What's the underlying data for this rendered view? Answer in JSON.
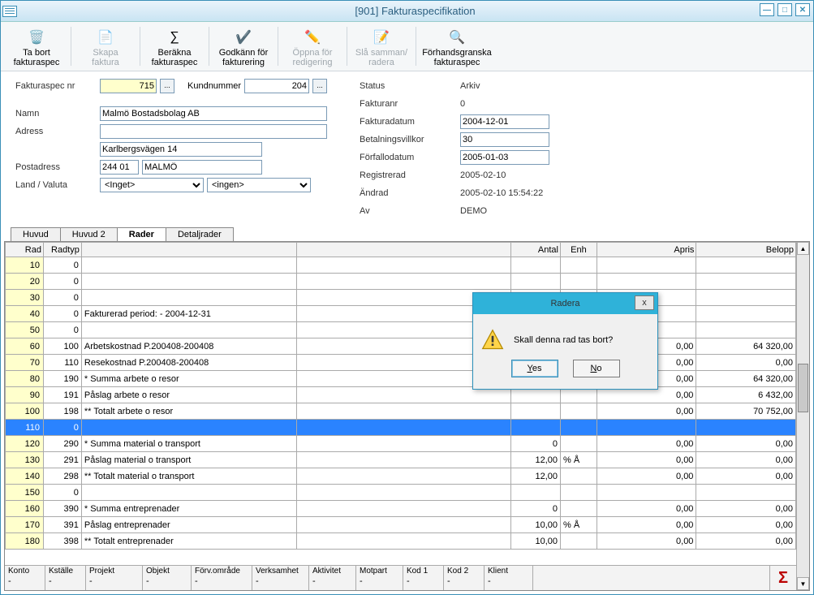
{
  "window": {
    "title": "[901]  Fakturaspecifikation"
  },
  "toolbar": {
    "remove": {
      "l1": "Ta bort",
      "l2": "fakturaspec"
    },
    "create": {
      "l1": "Skapa",
      "l2": "faktura"
    },
    "calc": {
      "l1": "Beräkna",
      "l2": "fakturaspec"
    },
    "approve": {
      "l1": "Godkänn för",
      "l2": "fakturering"
    },
    "openedit": {
      "l1": "Öppna för",
      "l2": "redigering"
    },
    "merge": {
      "l1": "Slå samman/",
      "l2": "radera"
    },
    "preview": {
      "l1": "Förhandsgranska",
      "l2": "fakturaspec"
    }
  },
  "form": {
    "labels": {
      "fakturaspec_nr": "Fakturaspec nr",
      "kundnummer": "Kundnummer",
      "namn": "Namn",
      "adress": "Adress",
      "postadress": "Postadress",
      "land_valuta": "Land / Valuta",
      "status": "Status",
      "fakturanr": "Fakturanr",
      "fakturadatum": "Fakturadatum",
      "betalningsvillkor": "Betalningsvillkor",
      "forfallodatum": "Förfallodatum",
      "registrerad": "Registrerad",
      "andrad": "Ändrad",
      "av": "Av"
    },
    "values": {
      "fakturaspec_nr": "715",
      "kundnummer": "204",
      "namn": "Malmö Bostadsbolag AB",
      "adress": "",
      "adress2": "Karlbergsvägen 14",
      "postnr": "244 01",
      "postort": "MALMÖ",
      "land_sel": "<Inget>",
      "valuta_sel": "<ingen>",
      "status": "Arkiv",
      "fakturanr": "0",
      "fakturadatum": "2004-12-01",
      "betalningsvillkor": "30",
      "forfallodatum": "2005-01-03",
      "registrerad": "2005-02-10",
      "andrad": "2005-02-10 15:54:22",
      "av": "DEMO"
    }
  },
  "tabs": {
    "t1": "Huvud",
    "t2": "Huvud 2",
    "t3": "Rader",
    "t4": "Detaljrader"
  },
  "grid": {
    "headers": {
      "rad": "Rad",
      "radtyp": "Radtyp",
      "text": "",
      "antal": "Antal",
      "enh": "Enh",
      "apris": "Apris",
      "belopp": "Belopp"
    },
    "rows": [
      {
        "rad": "10",
        "radtyp": "0",
        "text": "",
        "antal": "",
        "enh": "",
        "apris": "",
        "belopp": "",
        "sel": false
      },
      {
        "rad": "20",
        "radtyp": "0",
        "text": "",
        "antal": "",
        "enh": "",
        "apris": "",
        "belopp": "",
        "sel": false
      },
      {
        "rad": "30",
        "radtyp": "0",
        "text": "",
        "antal": "",
        "enh": "",
        "apris": "",
        "belopp": "",
        "sel": false
      },
      {
        "rad": "40",
        "radtyp": "0",
        "text": "Fakturerad period:  - 2004-12-31",
        "antal": "",
        "enh": "",
        "apris": "",
        "belopp": "",
        "sel": false
      },
      {
        "rad": "50",
        "radtyp": "0",
        "text": "",
        "antal": "",
        "enh": "",
        "apris": "",
        "belopp": "",
        "sel": false
      },
      {
        "rad": "60",
        "radtyp": "100",
        "text": "Arbetskostnad P.200408-200408",
        "antal": "",
        "enh": "",
        "apris": "0,00",
        "belopp": "64 320,00",
        "sel": false
      },
      {
        "rad": "70",
        "radtyp": "110",
        "text": "Resekostnad P.200408-200408",
        "antal": "",
        "enh": "",
        "apris": "0,00",
        "belopp": "0,00",
        "sel": false
      },
      {
        "rad": "80",
        "radtyp": "190",
        "text": "* Summa arbete o resor",
        "antal": "",
        "enh": "",
        "apris": "0,00",
        "belopp": "64 320,00",
        "sel": false
      },
      {
        "rad": "90",
        "radtyp": "191",
        "text": "Påslag arbete o resor",
        "antal": "",
        "enh": "",
        "apris": "0,00",
        "belopp": "6 432,00",
        "sel": false
      },
      {
        "rad": "100",
        "radtyp": "198",
        "text": "** Totalt arbete o resor",
        "antal": "",
        "enh": "",
        "apris": "0,00",
        "belopp": "70 752,00",
        "sel": false
      },
      {
        "rad": "110",
        "radtyp": "0",
        "text": "",
        "antal": "",
        "enh": "",
        "apris": "",
        "belopp": "",
        "sel": true
      },
      {
        "rad": "120",
        "radtyp": "290",
        "text": "* Summa material o transport",
        "antal": "0",
        "enh": "",
        "apris": "0,00",
        "belopp": "0,00",
        "sel": false
      },
      {
        "rad": "130",
        "radtyp": "291",
        "text": "Påslag material o transport",
        "antal": "12,00",
        "enh": "% Å",
        "apris": "0,00",
        "belopp": "0,00",
        "sel": false
      },
      {
        "rad": "140",
        "radtyp": "298",
        "text": "** Totalt material o transport",
        "antal": "12,00",
        "enh": "",
        "apris": "0,00",
        "belopp": "0,00",
        "sel": false
      },
      {
        "rad": "150",
        "radtyp": "0",
        "text": "",
        "antal": "",
        "enh": "",
        "apris": "",
        "belopp": "",
        "sel": false
      },
      {
        "rad": "160",
        "radtyp": "390",
        "text": "* Summa entreprenader",
        "antal": "0",
        "enh": "",
        "apris": "0,00",
        "belopp": "0,00",
        "sel": false
      },
      {
        "rad": "170",
        "radtyp": "391",
        "text": "Påslag entreprenader",
        "antal": "10,00",
        "enh": "% Å",
        "apris": "0,00",
        "belopp": "0,00",
        "sel": false
      },
      {
        "rad": "180",
        "radtyp": "398",
        "text": "** Totalt entreprenader",
        "antal": "10,00",
        "enh": "",
        "apris": "0,00",
        "belopp": "0,00",
        "sel": false
      }
    ]
  },
  "footer": {
    "cols": [
      "Konto",
      "Kställe",
      "Projekt",
      "Objekt",
      "Förv.område",
      "Verksamhet",
      "Aktivitet",
      "Motpart",
      "Kod 1",
      "Kod 2",
      "Klient"
    ],
    "vals": [
      "-",
      "-",
      "-",
      "-",
      "-",
      "-",
      "-",
      "-",
      "-",
      "-",
      "-",
      ""
    ]
  },
  "dialog": {
    "title": "Radera",
    "message": "Skall denna rad tas bort?",
    "yes": "Yes",
    "no": "No",
    "close": "x"
  }
}
